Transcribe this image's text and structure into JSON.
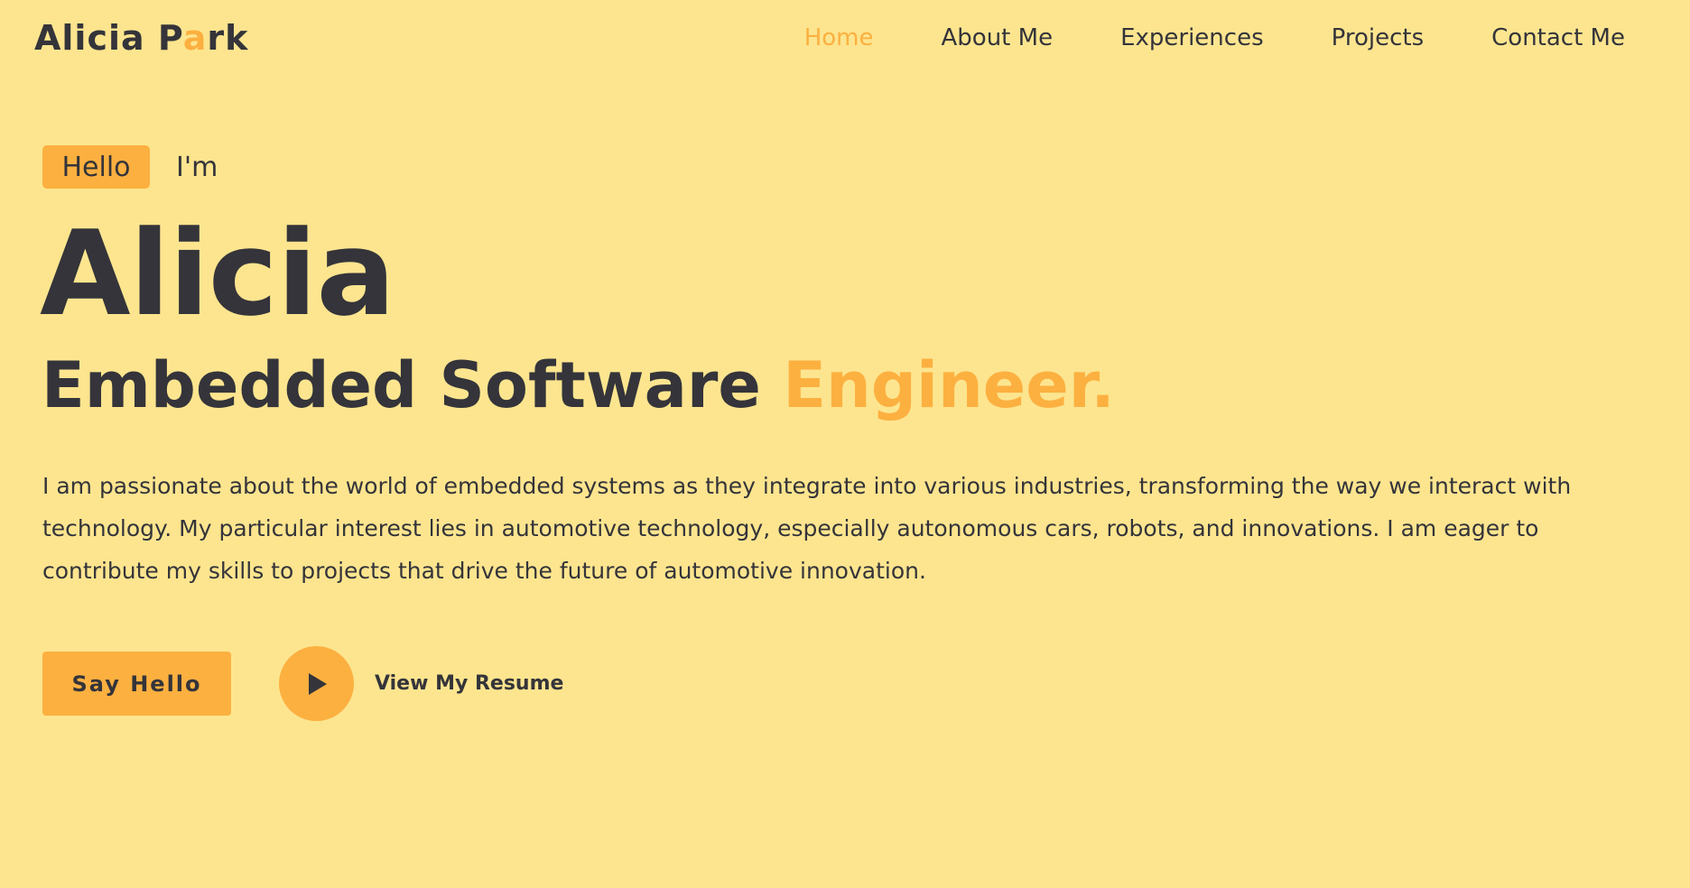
{
  "header": {
    "logo_prefix": "Alicia P",
    "logo_accent": "a",
    "logo_suffix": "rk",
    "nav": [
      {
        "label": "Home",
        "active": true
      },
      {
        "label": "About Me",
        "active": false
      },
      {
        "label": "Experiences",
        "active": false
      },
      {
        "label": "Projects",
        "active": false
      },
      {
        "label": "Contact Me",
        "active": false
      }
    ]
  },
  "hero": {
    "badge": "Hello",
    "intro": "I'm",
    "name": "Alicia",
    "role_main": "Embedded Software",
    "role_accent": "Engineer.",
    "bio": "I am passionate about the world of embedded systems as they integrate into various industries, transforming the way we interact with technology. My particular interest lies in automotive technology, especially autonomous cars, robots, and innovations. I am eager to contribute my skills to projects that drive the future of automotive innovation.",
    "cta_label": "Say Hello",
    "resume_icon": "play-icon",
    "resume_label": "View My Resume"
  },
  "colors": {
    "background": "#fde58f",
    "accent": "#fcb040",
    "text": "#34343a"
  }
}
